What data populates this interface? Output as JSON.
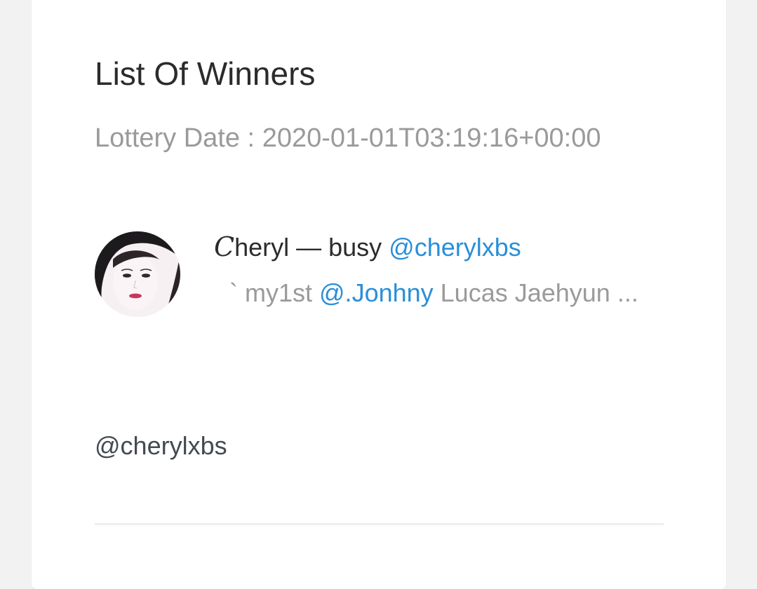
{
  "card": {
    "title": "List Of Winners",
    "lottery_date_label": "Lottery Date",
    "lottery_date_separator": " : ",
    "lottery_date_value": "2020-01-01T03:19:16+00:00"
  },
  "winners": [
    {
      "name_first_letter": "C",
      "name_rest": "heryl — busy ",
      "handle_mention": "@cherylxbs",
      "bio_prefix": "` my1st ",
      "bio_mention": "@.Jonhny",
      "bio_suffix": " Lucas Jaehyun ...",
      "avatar_icon": "profile-photo",
      "handle_footer": "@cherylxbs"
    }
  ],
  "colors": {
    "background": "#f2f2f2",
    "card": "#ffffff",
    "title_text": "#2b2b2b",
    "muted_text": "#9a9a9a",
    "mention_link": "#2a8fd8",
    "divider": "#eceff1"
  }
}
